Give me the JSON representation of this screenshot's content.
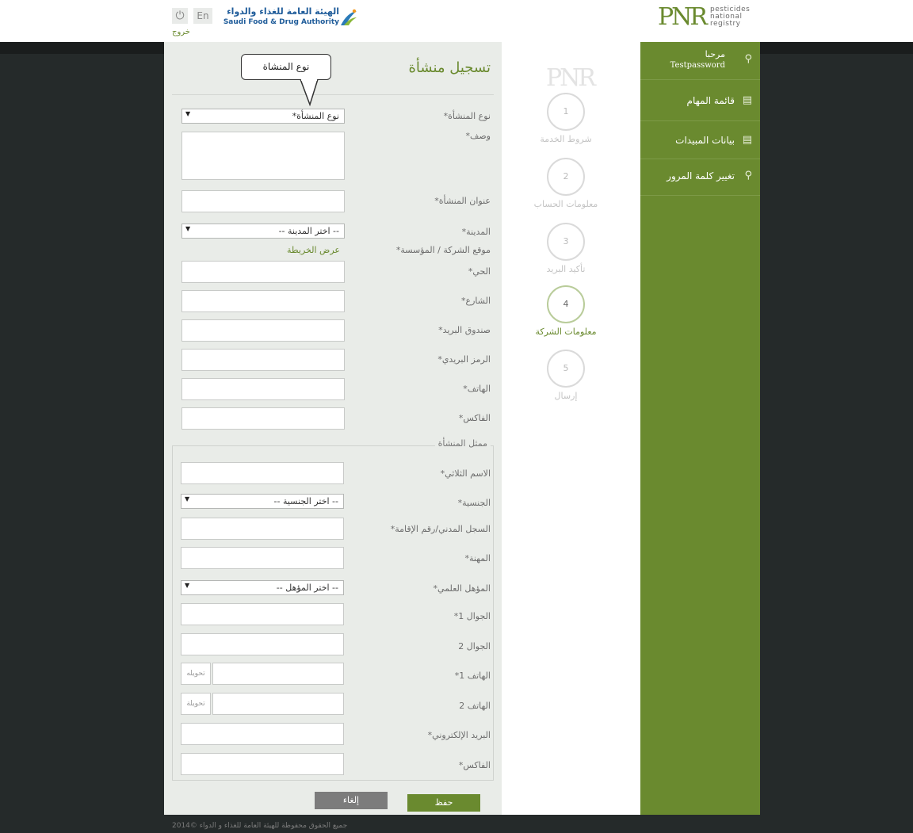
{
  "header": {
    "logout_label": "خروج",
    "lang_label": "En",
    "sfda_ar": "الهيئة العامة للغذاء والدواء",
    "sfda_en": "Saudi Food & Drug Authority",
    "pnr_letters": "PNR",
    "pnr_line1": "pesticides",
    "pnr_line2": "national",
    "pnr_line3": "registry"
  },
  "form": {
    "title": "تسجيل منشأة",
    "tooltip": "نوع المنشاة",
    "facility_type_label": "نوع المنشأة*",
    "facility_type_value": "نوع المنشأة*",
    "description_label": "وصف*",
    "address_label": "عنوان المنشأة*",
    "city_label": "المدينة*",
    "city_value": "-- اختر المدينة --",
    "location_label": "موقع الشركة / المؤسسة*",
    "map_link": "عرض الخريطة",
    "district_label": "الحي*",
    "street_label": "الشارع*",
    "po_box_label": "صندوق البريد*",
    "postal_code_label": "الرمز البريدي*",
    "phone_label": "الهاتف*",
    "fax_label": "الفاكس*",
    "rep_legend": "ممثل المنشأة",
    "rep_name_label": "الاسم الثلاثي*",
    "nationality_label": "الجنسية*",
    "nationality_value": "-- اختر الجنسية --",
    "id_label": "السجل المدني/رقم الإقامة*",
    "occupation_label": "المهنة*",
    "qualification_label": "المؤهل العلمي*",
    "qualification_value": "-- اختر المؤهل --",
    "mobile1_label": "الجوال 1*",
    "mobile2_label": "الجوال 2",
    "phone1_label": "الهاتف 1*",
    "phone1_ext": "تحويله",
    "phone2_label": "الهاتف 2",
    "phone2_ext": "تحويلة",
    "email_label": "البريد الإلكتروني*",
    "rep_fax_label": "الفاكس*",
    "save_label": "حفظ",
    "cancel_label": "إلغاء"
  },
  "steps": {
    "logo": "PNR",
    "items": [
      {
        "num": "1",
        "label": "شروط الخدمة"
      },
      {
        "num": "2",
        "label": "معلومات الحساب"
      },
      {
        "num": "3",
        "label": "تأكيد البريد"
      },
      {
        "num": "4",
        "label": "معلومات الشركة"
      },
      {
        "num": "5",
        "label": "إرسال"
      }
    ],
    "active": 4
  },
  "sidebar": {
    "welcome": "مرحبا",
    "username": "Testpassword",
    "items": [
      {
        "label": "قائمة المهام",
        "icon": "list-icon"
      },
      {
        "label": "بيانات المبيدات",
        "icon": "list-icon"
      },
      {
        "label": "تغيير كلمة المرور",
        "icon": "key-icon"
      }
    ]
  },
  "footer": {
    "copyright": "جميع الحقوق محفوظة للهيئة العامة للغذاء و الدواء ©2014"
  },
  "colors": {
    "brand_green": "#6a8a2f",
    "panel_bg": "#e9ece8",
    "dark_bg": "#252a2a"
  }
}
